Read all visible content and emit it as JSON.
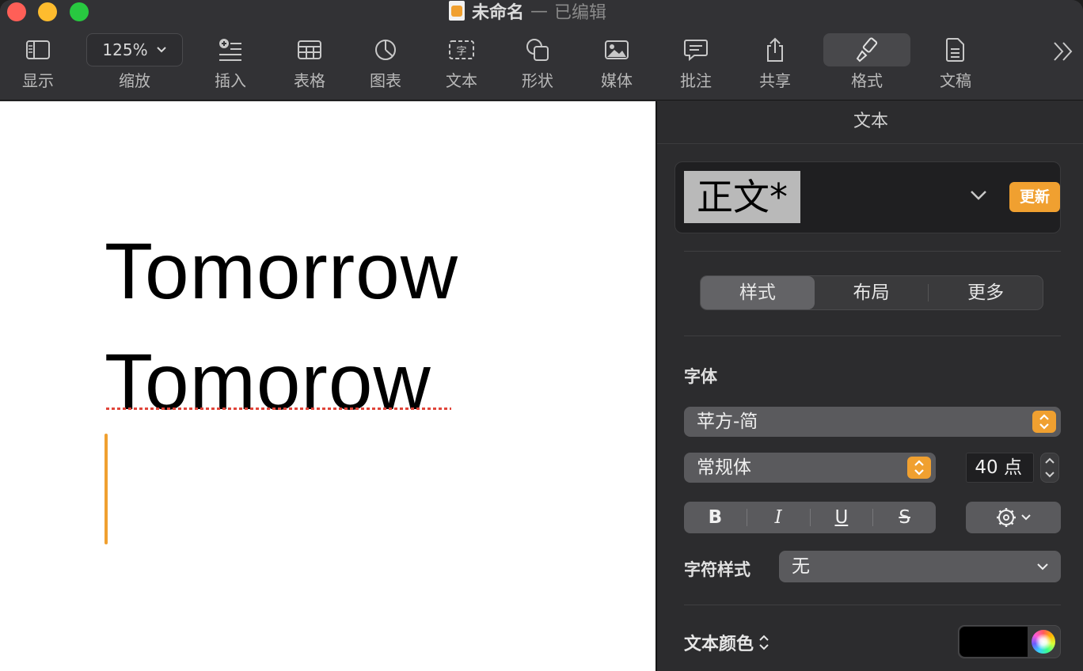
{
  "window": {
    "doc_name": "未命名",
    "separator": "—",
    "status": "已编辑"
  },
  "toolbar": {
    "view_label": "显示",
    "zoom_value": "125%",
    "zoom_label": "缩放",
    "insert_label": "插入",
    "table_label": "表格",
    "chart_label": "图表",
    "text_label": "文本",
    "shape_label": "形状",
    "media_label": "媒体",
    "comment_label": "批注",
    "share_label": "共享",
    "format_label": "格式",
    "document_label": "文稿"
  },
  "document": {
    "line1": "Tomorrow",
    "line2": "Tomorow"
  },
  "inspector": {
    "title": "文本",
    "paragraph_style": "正文*",
    "update_label": "更新",
    "tabs": [
      "样式",
      "布局",
      "更多"
    ],
    "font_section_label": "字体",
    "font_family": "苹方-简",
    "font_weight": "常规体",
    "font_size": "40 点",
    "bold": "B",
    "italic": "I",
    "underline": "U",
    "strike": "S",
    "char_style_label": "字符样式",
    "char_style_value": "无",
    "text_color_label": "文本颜色",
    "text_color": "#000000"
  },
  "colors": {
    "accent": "#f0a030",
    "spell_error": "#e0453a"
  }
}
